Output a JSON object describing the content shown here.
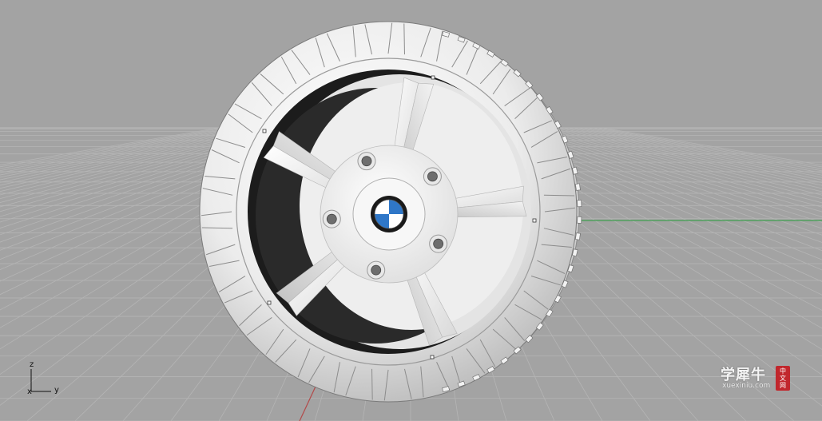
{
  "viewport": {
    "projection": "perspective",
    "display_mode": "shaded",
    "background_color": "#a3a3a3",
    "grid_color": "#b5b5b5",
    "x_axis_color": "#b24a4a",
    "y_axis_color": "#3f9f4f"
  },
  "model": {
    "object": "wheel",
    "rim_spokes": 5,
    "lug_holes": 5,
    "hub_emblem": "bmw-roundel",
    "emblem_colors": {
      "blue": "#2f77c8",
      "white": "#ffffff",
      "ring": "#1a1a1a"
    }
  },
  "axis_triad": {
    "z_label": "z",
    "x_label": "x",
    "y_label": "y"
  },
  "watermark": {
    "title": "学犀牛",
    "url": "xuexiniu.com",
    "stamp": [
      "中",
      "文",
      "网"
    ],
    "stamp_color": "#c1272d"
  }
}
